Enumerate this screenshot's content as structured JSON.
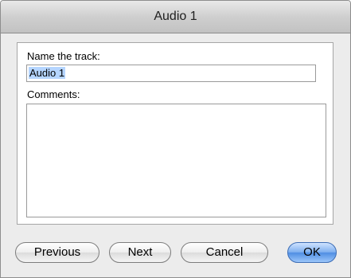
{
  "window": {
    "title": "Audio 1"
  },
  "form": {
    "name_label": "Name the track:",
    "name_value": "Audio 1",
    "comments_label": "Comments:",
    "comments_value": ""
  },
  "buttons": {
    "previous": "Previous",
    "next": "Next",
    "cancel": "Cancel",
    "ok": "OK"
  },
  "colors": {
    "selection": "#b5d5ff",
    "default_button": "#4f8ee3",
    "dialog_background": "#ececec"
  }
}
